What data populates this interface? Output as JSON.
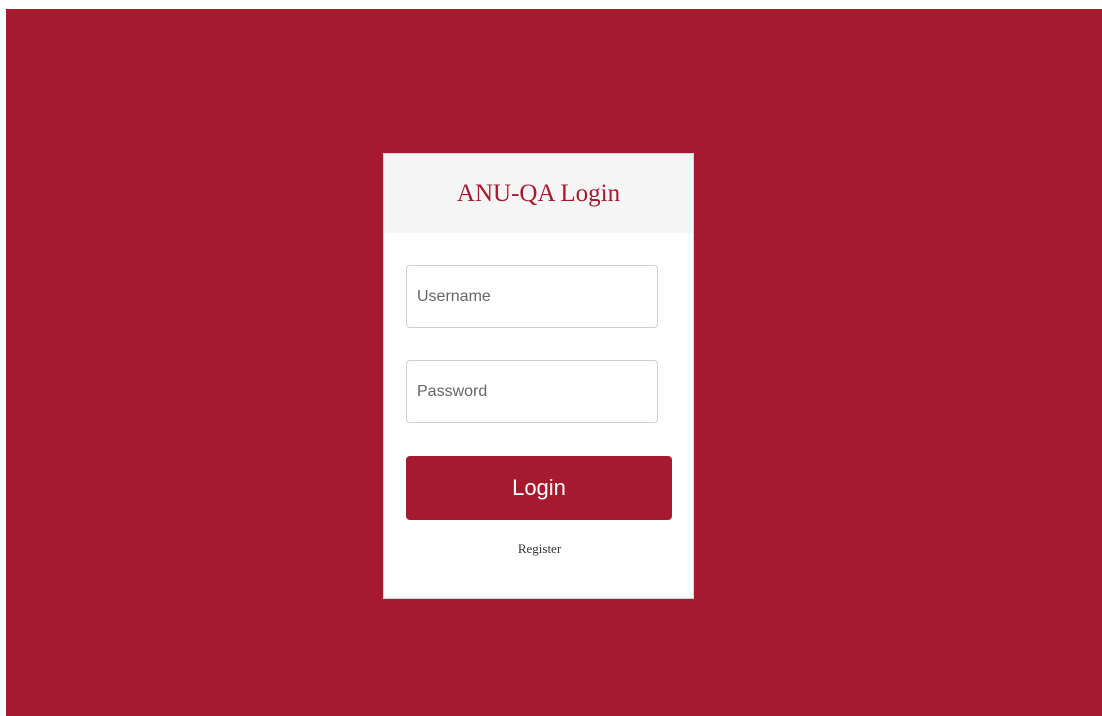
{
  "login_card": {
    "title": "ANU-QA Login",
    "username_placeholder": "Username",
    "password_placeholder": "Password",
    "login_label": "Login",
    "register_label": "Register"
  },
  "colors": {
    "brand": "#a61a2f",
    "header_bg": "#f5f5f5",
    "card_bg": "#ffffff"
  }
}
